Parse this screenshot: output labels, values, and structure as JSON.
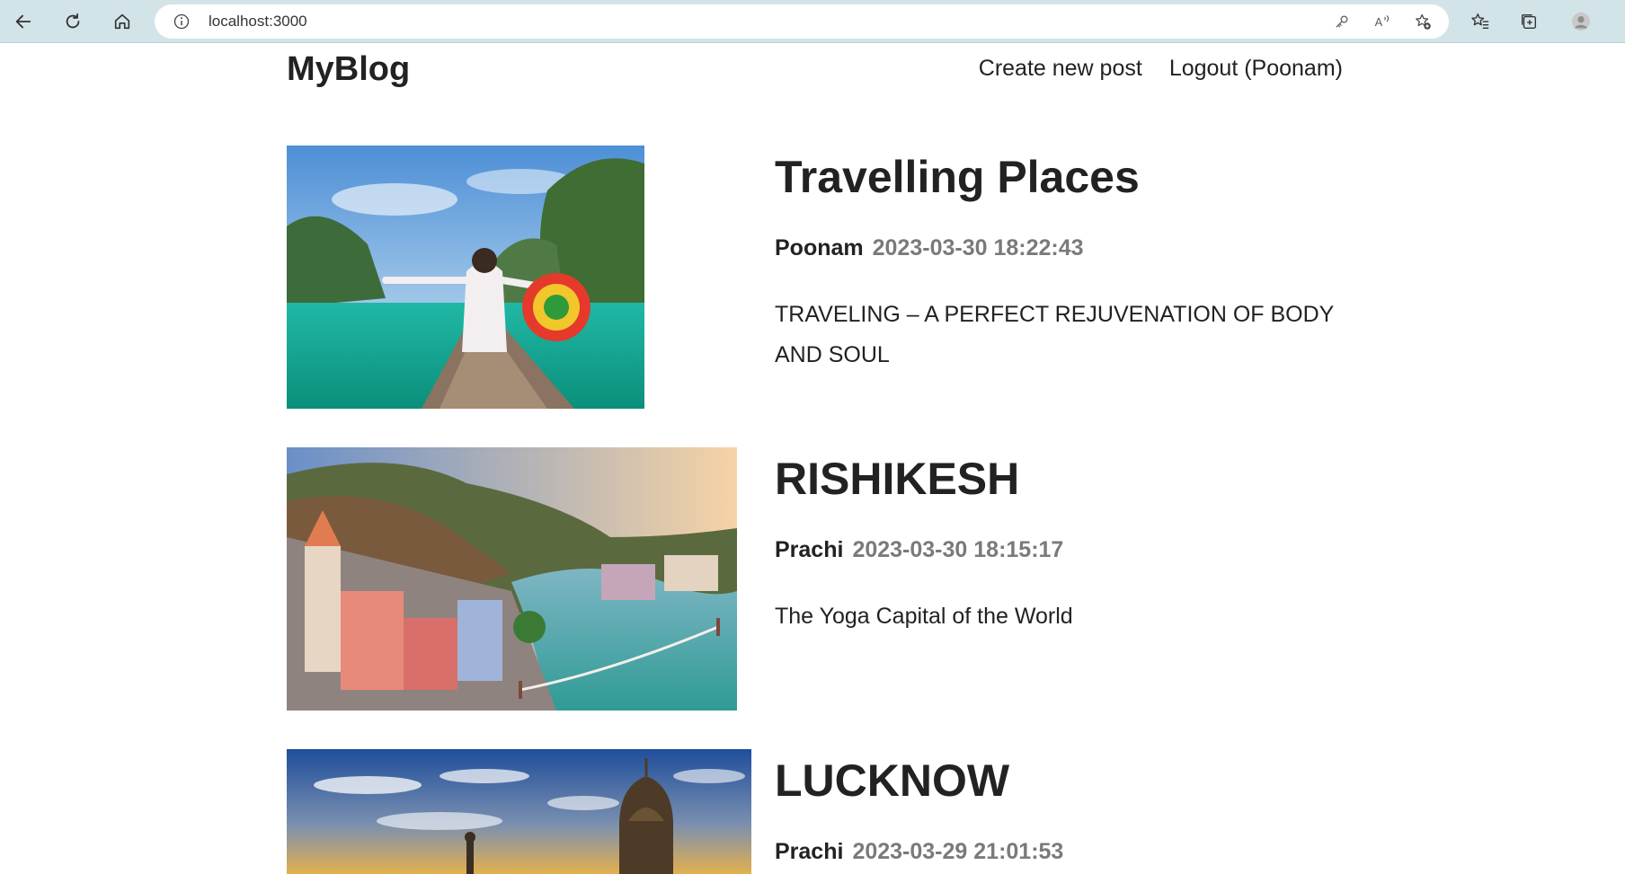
{
  "browser": {
    "url": "localhost:3000",
    "icons": [
      "back-icon",
      "refresh-icon",
      "home-icon",
      "info-icon",
      "key-icon",
      "read-aloud-icon",
      "add-favorite-icon",
      "favorites-icon",
      "collections-icon",
      "profile-icon"
    ]
  },
  "header": {
    "logo": "MyBlog",
    "create_link": "Create new post",
    "logout_link": "Logout (Poonam)"
  },
  "posts": [
    {
      "title": "Travelling Places",
      "author": "Poonam",
      "time": "2023-03-30 18:22:43",
      "summary": "TRAVELING – A PERFECT REJUVENATION OF BODY AND SOUL"
    },
    {
      "title": "RISHIKESH",
      "author": "Prachi",
      "time": "2023-03-30 18:15:17",
      "summary": "The Yoga Capital of the World"
    },
    {
      "title": "LUCKNOW",
      "author": "Prachi",
      "time": "2023-03-29 21:01:53",
      "summary": ""
    }
  ],
  "colors": {
    "browser_bar": "#d3e4e9",
    "text": "#222222",
    "time_text": "#7a7a7a"
  }
}
